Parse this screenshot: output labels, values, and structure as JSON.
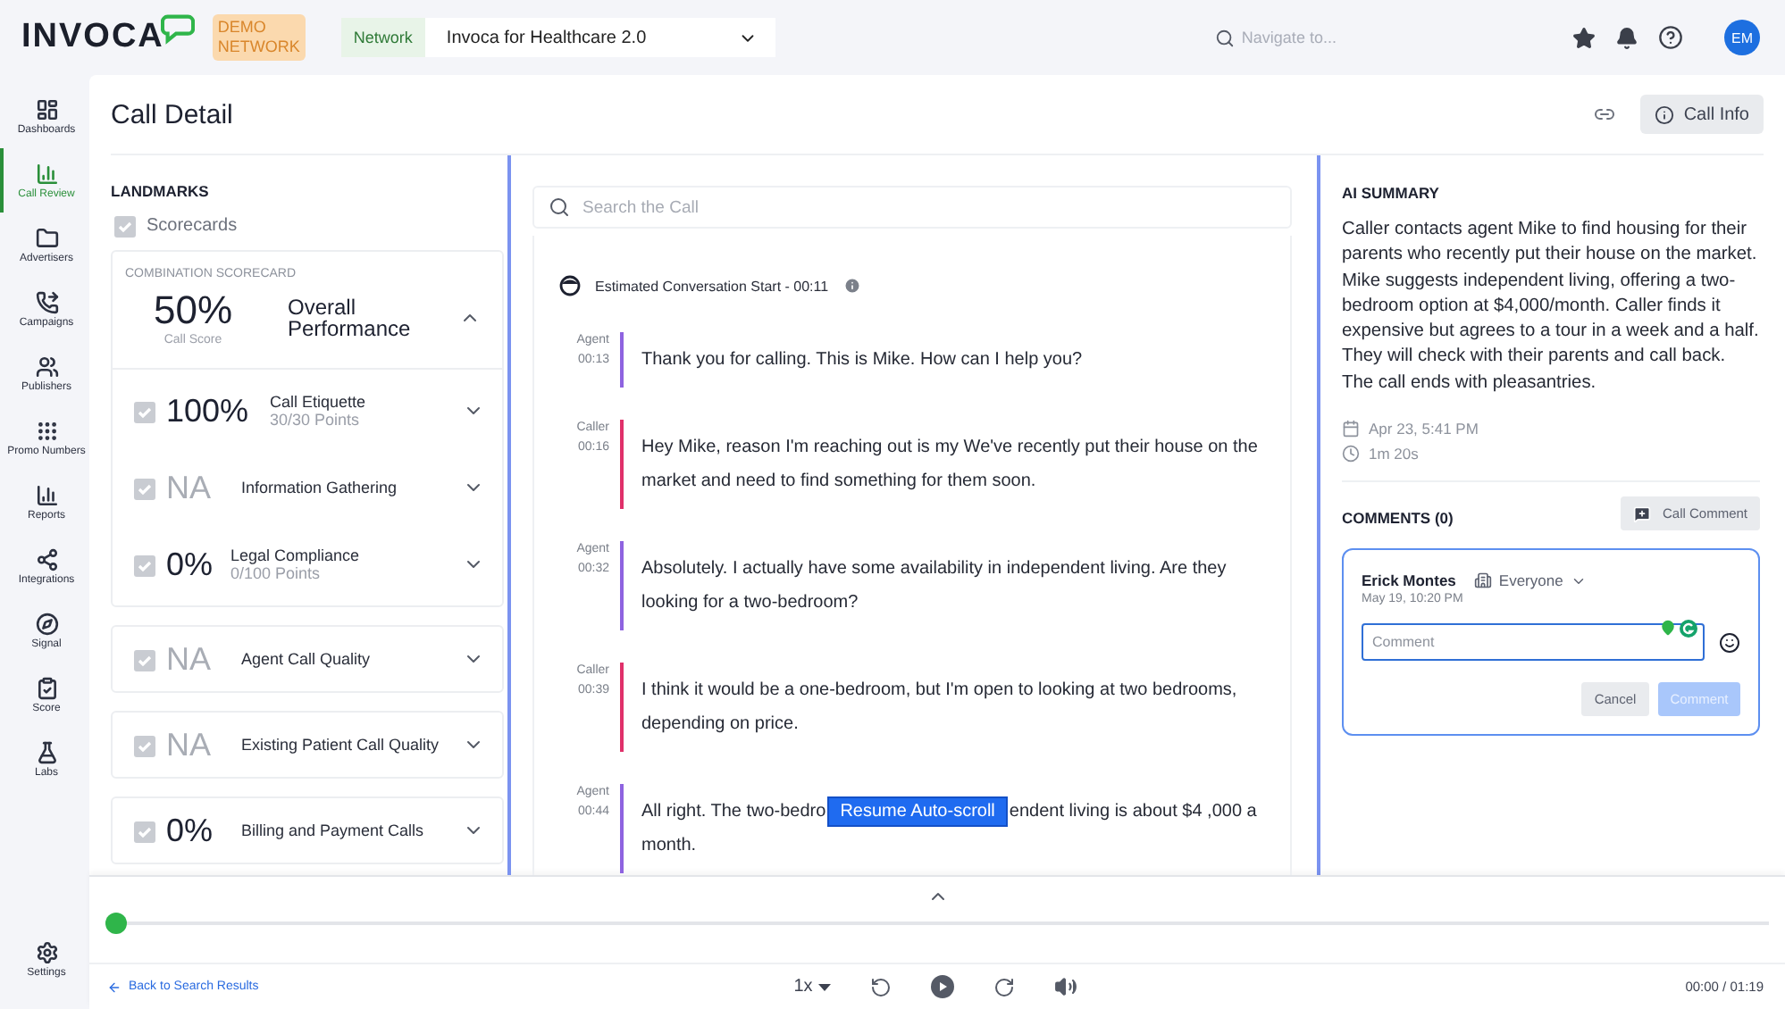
{
  "topbar": {
    "logo": "INVOCA",
    "badge": "DEMO NETWORK",
    "network_label": "Network",
    "network_select": "Invoca for Healthcare 2.0",
    "search": {
      "placeholder": "Navigate to..."
    },
    "avatar": "EM"
  },
  "sidebar": {
    "items": [
      {
        "label": "Dashboards",
        "kind": "dashboards",
        "selected": false
      },
      {
        "label": "Call Review",
        "kind": "callreview",
        "selected": true
      },
      {
        "label": "Advertisers",
        "kind": "advertisers",
        "selected": false
      },
      {
        "label": "Campaigns",
        "kind": "campaigns",
        "selected": false
      },
      {
        "label": "Publishers",
        "kind": "publishers",
        "selected": false
      },
      {
        "label": "Promo Numbers",
        "kind": "promo",
        "selected": false
      },
      {
        "label": "Reports",
        "kind": "reports",
        "selected": false
      },
      {
        "label": "Integrations",
        "kind": "integrations",
        "selected": false
      },
      {
        "label": "Signal",
        "kind": "signal",
        "selected": false
      },
      {
        "label": "Score",
        "kind": "score",
        "selected": false
      },
      {
        "label": "Labs",
        "kind": "labs",
        "selected": false
      }
    ],
    "footer": {
      "label": "Settings",
      "kind": "settings",
      "selected": false
    }
  },
  "page": {
    "title": "Call Detail",
    "call_info_button": "Call Info"
  },
  "landmarks": {
    "heading": "LANDMARKS",
    "section": "Scorecards",
    "combination": {
      "title": "COMBINATION SCORECARD",
      "score": "50%",
      "score_label": "Call Score",
      "name": "Overall Performance",
      "expanded": true,
      "items": [
        {
          "score": "100%",
          "name": "Call Etiquette",
          "points": "30/30 Points",
          "applicable": true,
          "expanded": false
        },
        {
          "score": "NA",
          "name": "Information Gathering",
          "applicable": false,
          "expanded": false
        },
        {
          "score": "0%",
          "name": "Legal Compliance",
          "points": "0/100 Points",
          "applicable": true,
          "expanded": false
        }
      ]
    },
    "scorecards": [
      {
        "score": "NA",
        "name": "Agent Call Quality",
        "applicable": false,
        "expanded": false
      },
      {
        "score": "NA",
        "name": "Existing Patient Call Quality",
        "applicable": false,
        "expanded": false
      },
      {
        "score": "0%",
        "name": "Billing and Payment Calls",
        "applicable": true,
        "expanded": false
      }
    ]
  },
  "transcript": {
    "search": {
      "placeholder": "Search the Call"
    },
    "start": "Estimated Conversation Start - 00:11",
    "messages": [
      {
        "kind": "agent",
        "speaker": "Agent",
        "time": "00:13",
        "text": "Thank you for calling. This is Mike. How can I help you?"
      },
      {
        "kind": "caller",
        "speaker": "Caller",
        "time": "00:16",
        "text": "Hey Mike, reason I'm reaching out is my We've recently put their house on the market and need to find something for them soon."
      },
      {
        "kind": "agent",
        "speaker": "Agent",
        "time": "00:32",
        "text": "Absolutely. I actually have some availability in independent living. Are they looking for a two-bedroom?"
      },
      {
        "kind": "caller",
        "speaker": "Caller",
        "time": "00:39",
        "text": "I think it would be a one-bedroom, but I'm open to looking at two bedrooms, depending on price."
      },
      {
        "kind": "agent",
        "speaker": "Agent",
        "time": "00:44",
        "text": "All right. The two-bedro",
        "text_after": "endent living is about $4 ,000 a",
        "text_next_line": "month.",
        "overlay_button": "Resume Auto-scroll"
      }
    ]
  },
  "summary": {
    "heading": "AI SUMMARY",
    "text": "Caller contacts agent Mike to find housing for their parents who recently put their house on the market. Mike suggests independent living, offering a two-bedroom option at $4,000/month. Caller finds it expensive but agrees to a tour in a week and a half. They will check with their parents and call back. The call ends with pleasantries.",
    "date": "Apr 23, 5:41 PM",
    "duration": "1m 20s"
  },
  "comments": {
    "heading": "COMMENTS (0)",
    "add_button": "Call Comment",
    "draft": {
      "author": "Erick Montes",
      "visibility": "Everyone",
      "date": "May 19, 10:20 PM",
      "placeholder": "Comment",
      "cancel": "Cancel",
      "submit": "Comment",
      "submit_disabled": true
    }
  },
  "player": {
    "level": 0,
    "back_link": "Back to Search Results",
    "speed": "1x",
    "time": "00:00 / 01:19"
  }
}
